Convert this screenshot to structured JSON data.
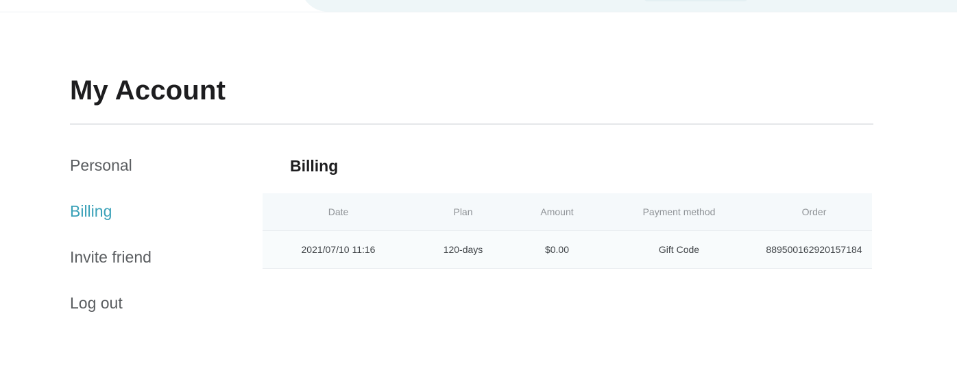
{
  "page": {
    "title": "My Account"
  },
  "nav": {
    "items": [
      {
        "label": "Personal",
        "active": false
      },
      {
        "label": "Billing",
        "active": true
      },
      {
        "label": "Invite friend",
        "active": false
      },
      {
        "label": "Log out",
        "active": false
      }
    ]
  },
  "billing": {
    "title": "Billing",
    "columns": [
      "Date",
      "Plan",
      "Amount",
      "Payment method",
      "Order"
    ],
    "rows": [
      {
        "date": "2021/07/10 11:16",
        "plan": "120-days",
        "amount": "$0.00",
        "payment_method": "Gift Code",
        "order": "889500162920157184"
      }
    ]
  },
  "colors": {
    "accent": "#3aa1b8",
    "heading": "#1d1d1f",
    "nav_text": "#5a5d60",
    "table_header_bg": "#f5f9fb"
  }
}
